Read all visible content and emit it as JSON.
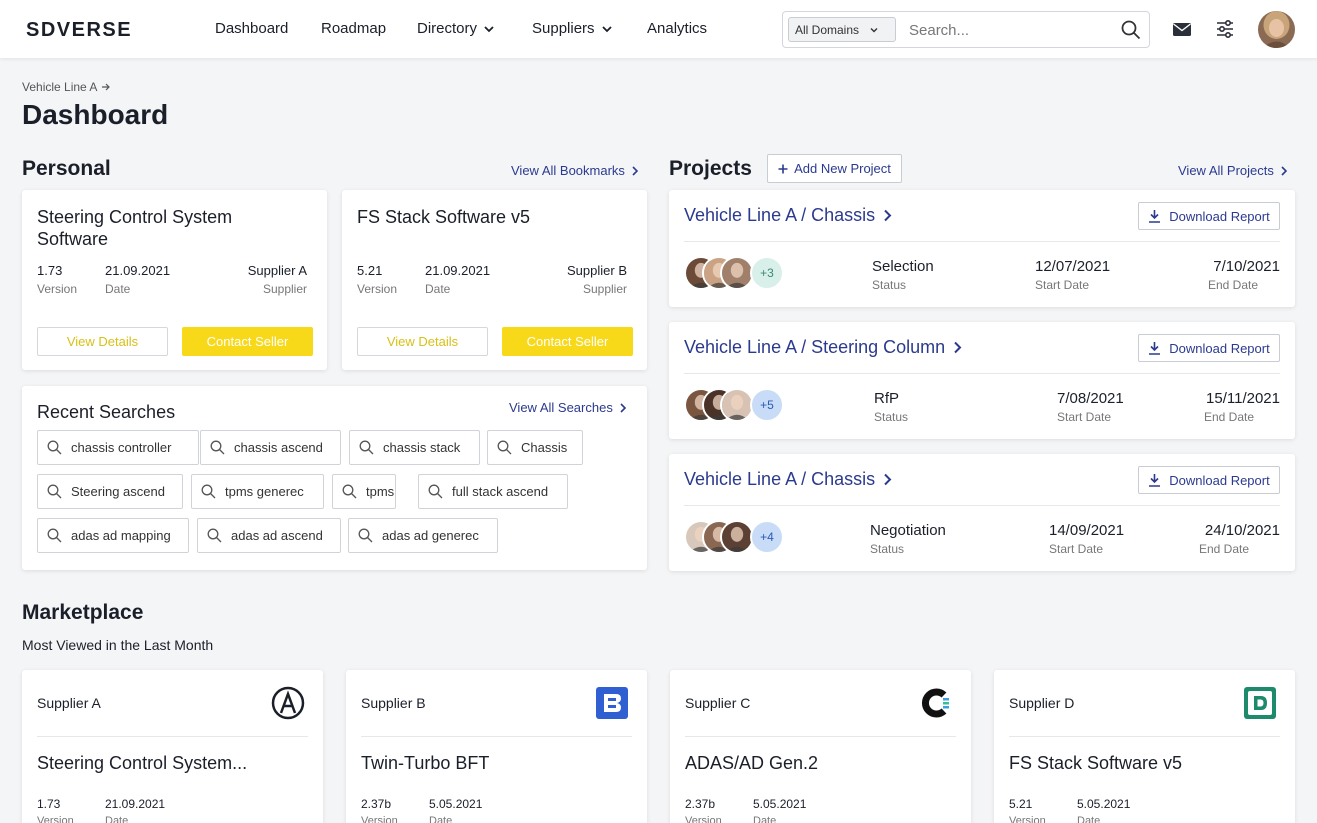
{
  "header": {
    "logo_text": "SDVERSE",
    "nav": [
      {
        "label": "Dashboard"
      },
      {
        "label": "Roadmap"
      },
      {
        "label": "Directory"
      },
      {
        "label": "Suppliers"
      },
      {
        "label": "Analytics"
      }
    ],
    "domain_select": "All Domains",
    "search_placeholder": "Search..."
  },
  "breadcrumb": "Vehicle Line A",
  "page_title": "Dashboard",
  "personal": {
    "title": "Personal",
    "view_all": "View All Bookmarks",
    "bookmarks": [
      {
        "title": "Steering Control System Software",
        "version": "1.73",
        "version_label": "Version",
        "date": "21.09.2021",
        "date_label": "Date",
        "supplier": "Supplier A",
        "supplier_label": "Supplier",
        "details_label": "View Details",
        "contact_label": "Contact Seller"
      },
      {
        "title": "FS Stack Software v5",
        "version": "5.21",
        "version_label": "Version",
        "date": "21.09.2021",
        "date_label": "Date",
        "supplier": "Supplier B",
        "supplier_label": "Supplier",
        "details_label": "View Details",
        "contact_label": "Contact Seller"
      }
    ]
  },
  "recent_searches": {
    "title": "Recent Searches",
    "view_all": "View All Searches",
    "chips": [
      "chassis controller",
      "chassis ascend",
      "chassis stack",
      "Chassis",
      "Steering ascend",
      "tpms generec",
      "tpms",
      "full stack ascend",
      "adas ad mapping",
      "adas ad ascend",
      "adas ad generec"
    ]
  },
  "projects": {
    "title": "Projects",
    "add_label": "Add New Project",
    "view_all": "View All Projects",
    "download_label": "Download Report",
    "status_label": "Status",
    "start_label": "Start Date",
    "end_label": "End Date",
    "items": [
      {
        "title": "Vehicle Line A / Chassis",
        "more": "+3",
        "status": "Selection",
        "start": "12/07/2021",
        "end": "7/10/2021"
      },
      {
        "title": "Vehicle Line A / Steering Column",
        "more": "+5",
        "status": "RfP",
        "start": "7/08/2021",
        "end": "15/11/2021"
      },
      {
        "title": "Vehicle Line A / Chassis",
        "more": "+4",
        "status": "Negotiation",
        "start": "14/09/2021",
        "end": "24/10/2021"
      }
    ]
  },
  "marketplace": {
    "title": "Marketplace",
    "subtitle": "Most Viewed in the Last Month",
    "items": [
      {
        "supplier": "Supplier A",
        "name": "Steering Control System...",
        "version": "1.73",
        "date": "21.09.2021",
        "version_label": "Version",
        "date_label": "Date",
        "logo_icon": "supplier-a-logo",
        "logo_letter": "A"
      },
      {
        "supplier": "Supplier B",
        "name": "Twin-Turbo BFT",
        "version": "2.37b",
        "date": "5.05.2021",
        "version_label": "Version",
        "date_label": "Date",
        "logo_icon": "supplier-b-logo",
        "logo_letter": "B"
      },
      {
        "supplier": "Supplier C",
        "name": "ADAS/AD Gen.2",
        "version": "2.37b",
        "date": "5.05.2021",
        "version_label": "Version",
        "date_label": "Date",
        "logo_icon": "supplier-c-logo"
      },
      {
        "supplier": "Supplier D",
        "name": "FS Stack Software v5",
        "version": "5.21",
        "date": "5.05.2021",
        "version_label": "Version",
        "date_label": "Date",
        "logo_icon": "supplier-d-logo",
        "logo_letter": "D"
      }
    ]
  },
  "colors": {
    "accent_blue": "#2b3a8f",
    "yellow": "#f7d91a",
    "supplier_b_blue": "#2f5fd1",
    "supplier_d_green": "#1d8a6b"
  }
}
